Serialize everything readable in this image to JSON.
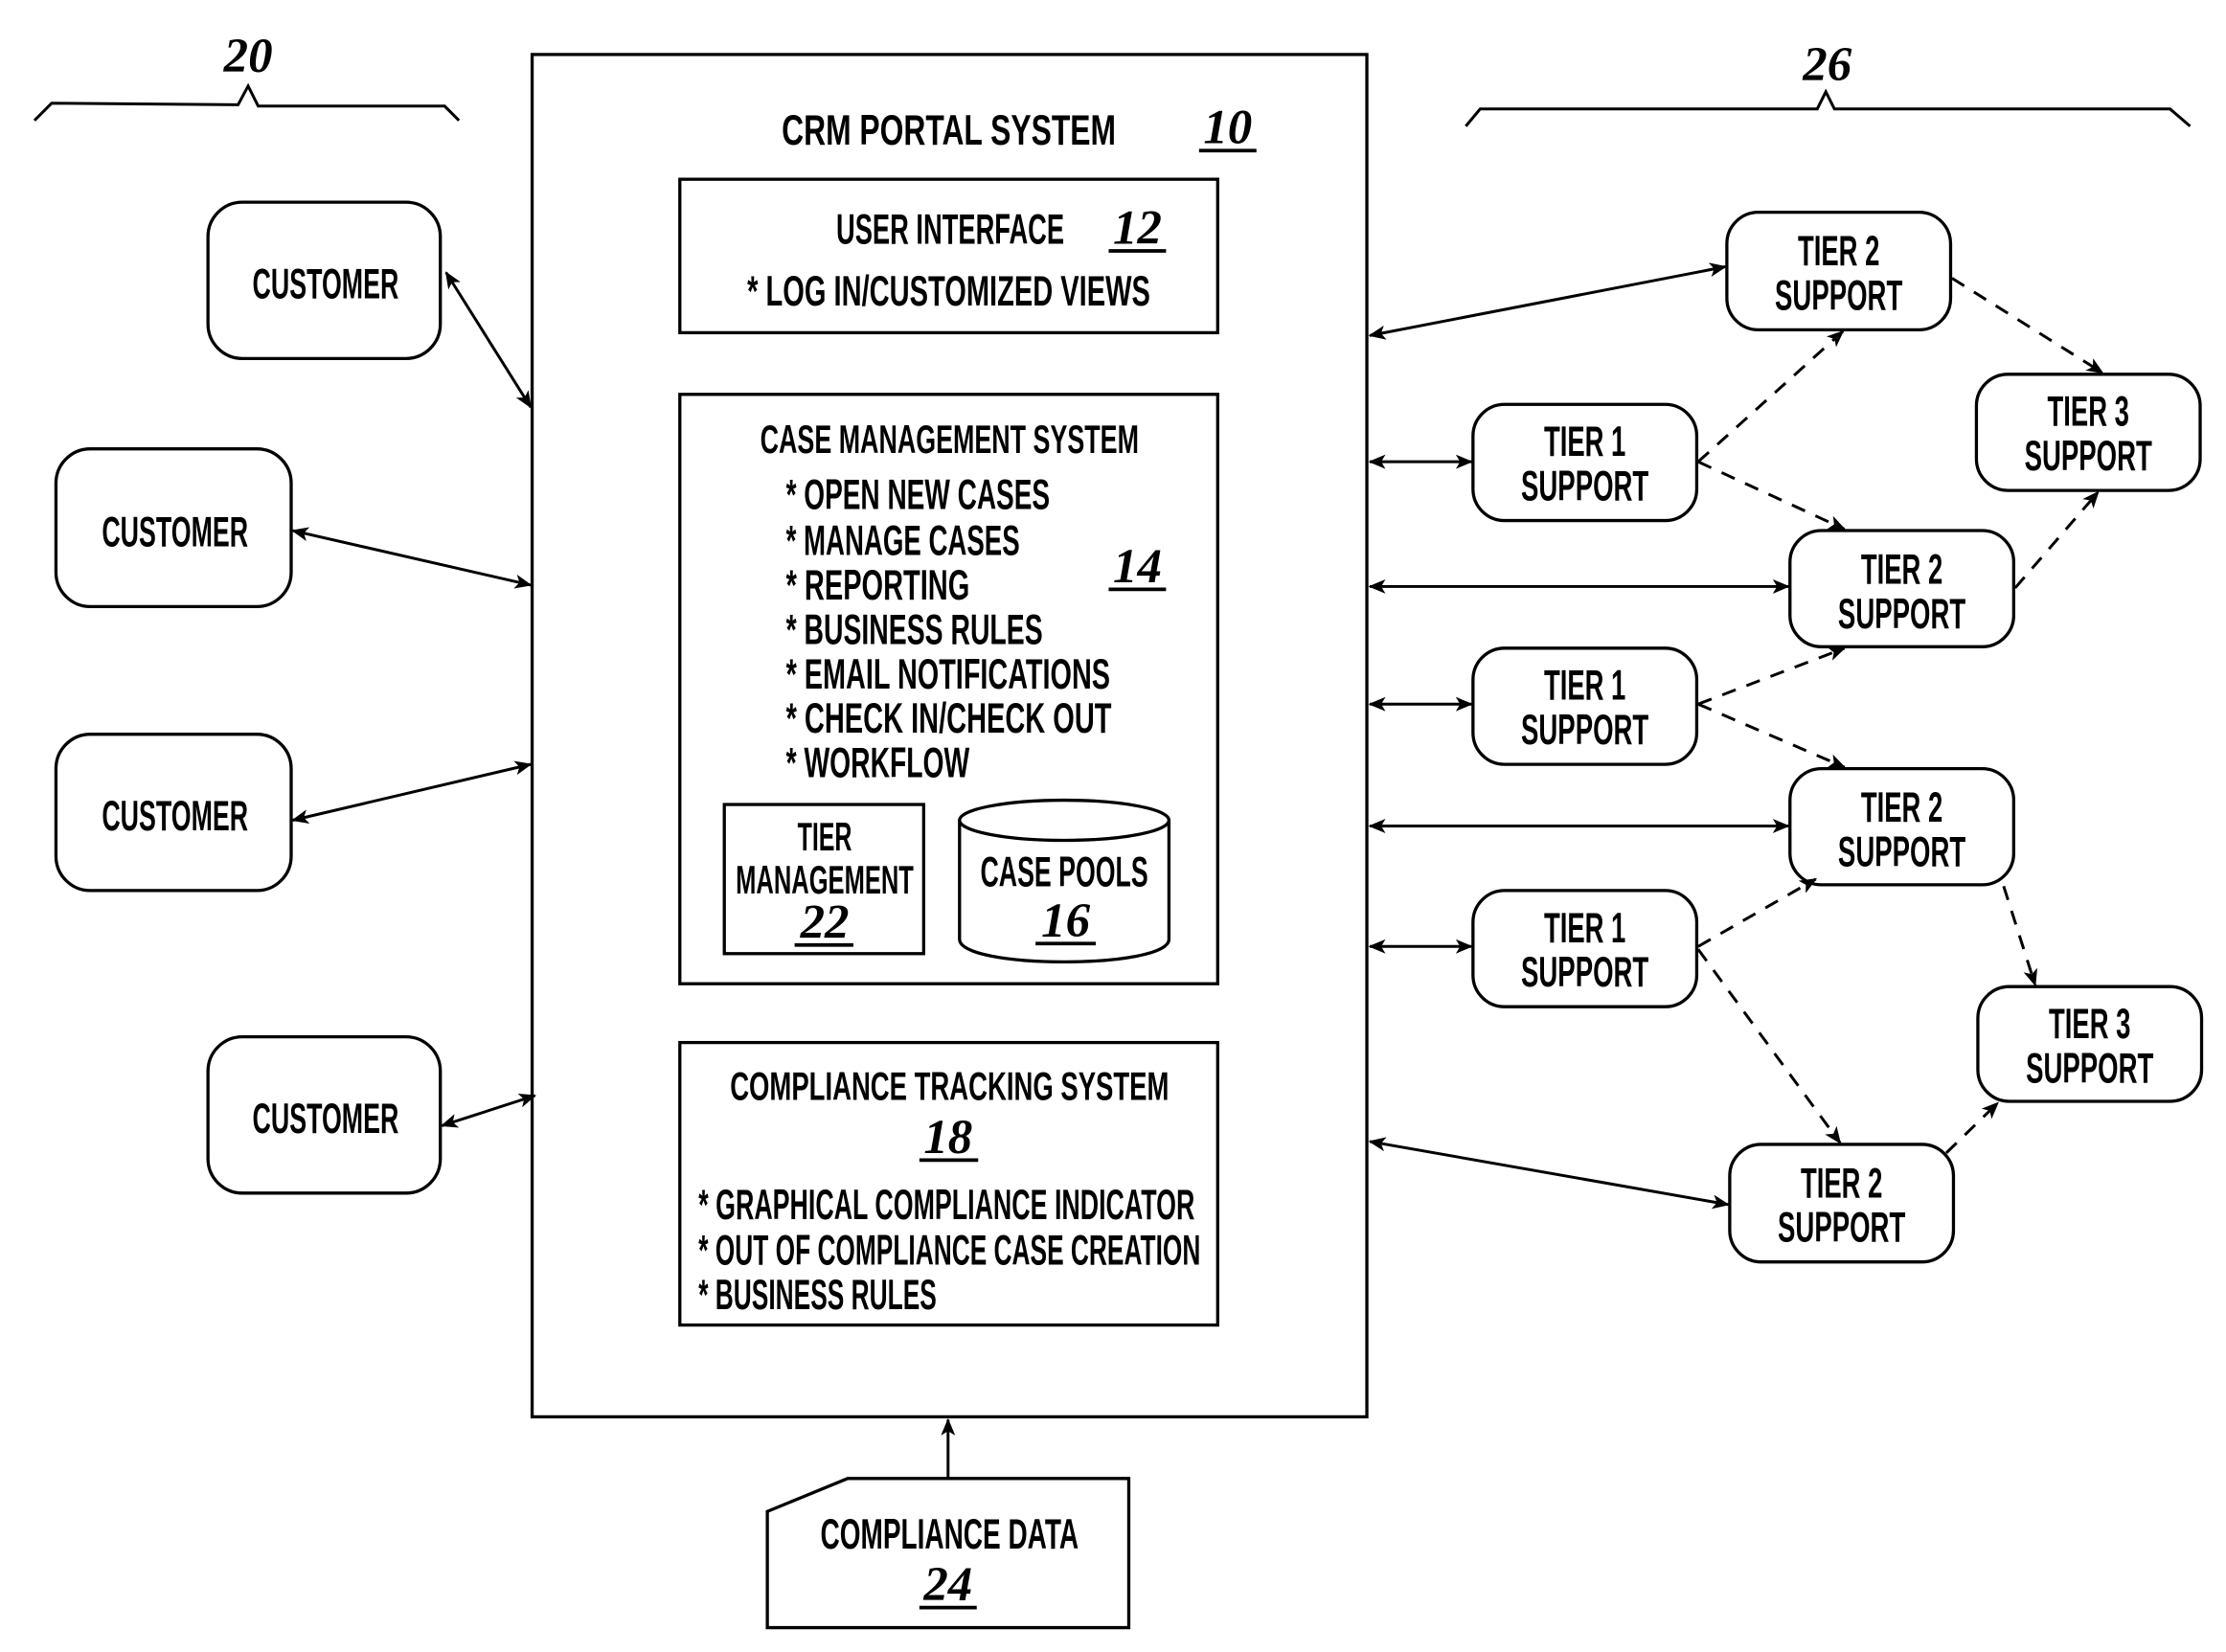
{
  "diagram": {
    "customer_group": {
      "ref": "20",
      "customers": [
        "CUSTOMER",
        "CUSTOMER",
        "CUSTOMER",
        "CUSTOMER"
      ]
    },
    "support_group": {
      "ref": "26",
      "nodes": [
        {
          "id": "t2a",
          "line1": "TIER 2",
          "line2": "SUPPORT"
        },
        {
          "id": "t3a",
          "line1": "TIER 3",
          "line2": "SUPPORT"
        },
        {
          "id": "t1a",
          "line1": "TIER 1",
          "line2": "SUPPORT"
        },
        {
          "id": "t2b",
          "line1": "TIER 2",
          "line2": "SUPPORT"
        },
        {
          "id": "t1b",
          "line1": "TIER 1",
          "line2": "SUPPORT"
        },
        {
          "id": "t2c",
          "line1": "TIER 2",
          "line2": "SUPPORT"
        },
        {
          "id": "t1c",
          "line1": "TIER 1",
          "line2": "SUPPORT"
        },
        {
          "id": "t3b",
          "line1": "TIER 3",
          "line2": "SUPPORT"
        },
        {
          "id": "t2d",
          "line1": "TIER 2",
          "line2": "SUPPORT"
        }
      ]
    },
    "crm": {
      "title": "CRM PORTAL SYSTEM",
      "ref": "10",
      "user_interface": {
        "title": "USER INTERFACE",
        "ref": "12",
        "items": [
          "* LOG IN/CUSTOMIZED VIEWS"
        ]
      },
      "case_management": {
        "title": "CASE MANAGEMENT SYSTEM",
        "ref": "14",
        "items": [
          "* OPEN NEW CASES",
          "* MANAGE CASES",
          "* REPORTING",
          "* BUSINESS RULES",
          "* EMAIL NOTIFICATIONS",
          "* CHECK IN/CHECK OUT",
          "* WORKFLOW"
        ],
        "tier_management": {
          "line1": "TIER",
          "line2": "MANAGEMENT",
          "ref": "22"
        },
        "case_pools": {
          "title": "CASE POOLS",
          "ref": "16"
        }
      },
      "compliance_tracking": {
        "title": "COMPLIANCE TRACKING SYSTEM",
        "ref": "18",
        "items": [
          "* GRAPHICAL COMPLIANCE INDICATOR",
          "* OUT OF COMPLIANCE CASE CREATION",
          "* BUSINESS RULES"
        ]
      }
    },
    "compliance_data": {
      "title": "COMPLIANCE DATA",
      "ref": "24"
    }
  }
}
